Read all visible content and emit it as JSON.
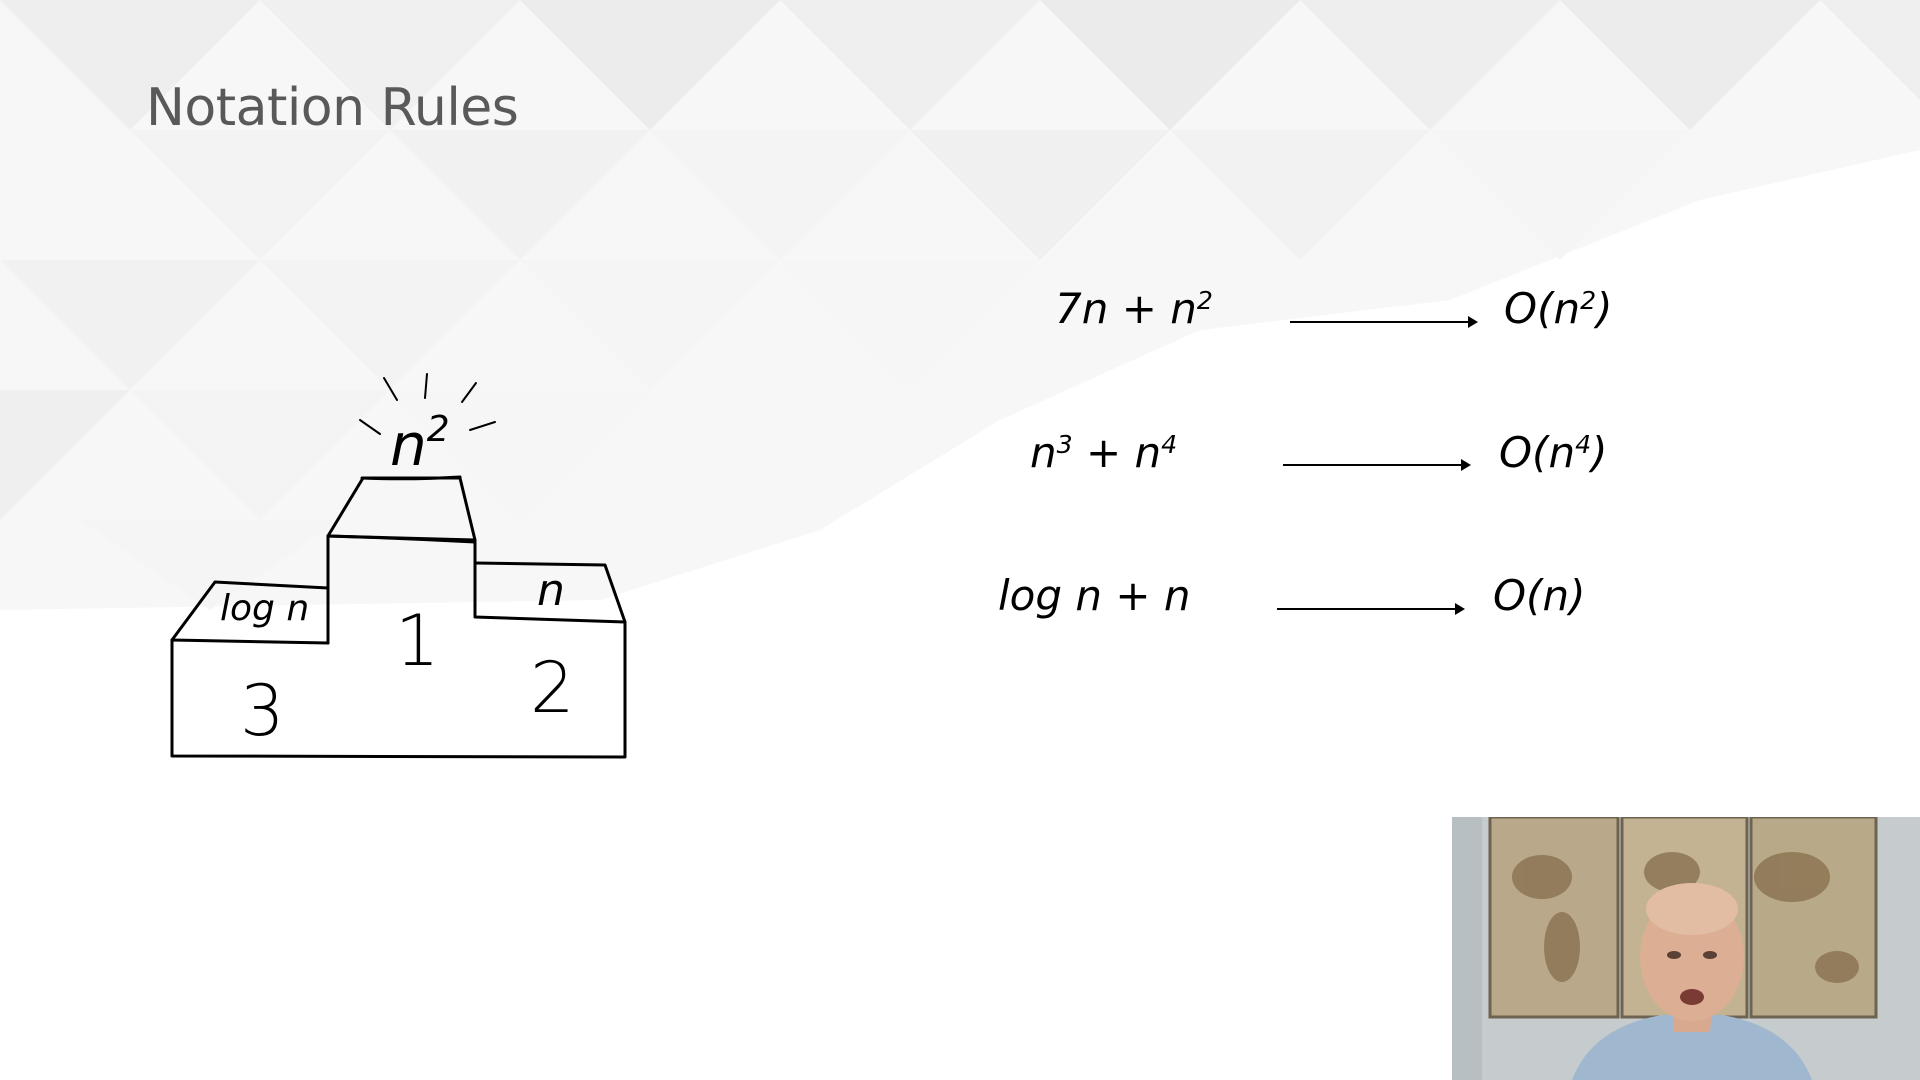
{
  "slide": {
    "title": "Notation Rules"
  },
  "podium": {
    "top_label_base": "n",
    "top_label_exp": "2",
    "first_place": "1",
    "second_place": "2",
    "third_place": "3",
    "second_label": "n",
    "third_label": "log n"
  },
  "rules": [
    {
      "expr_html": "7n + n<sup>2</sup>",
      "result_html": "O(n<sup>2</sup>)"
    },
    {
      "expr_html": "n<sup>3</sup> + n<sup>4</sup>",
      "result_html": "O(n<sup>4</sup>)"
    },
    {
      "expr_html": "log n + n",
      "result_html": "O(n)"
    }
  ],
  "colors": {
    "title": "#595959",
    "background": "#ffffff",
    "triangle_light": "#f2f2f2",
    "triangle_mid": "#ebebeb"
  }
}
